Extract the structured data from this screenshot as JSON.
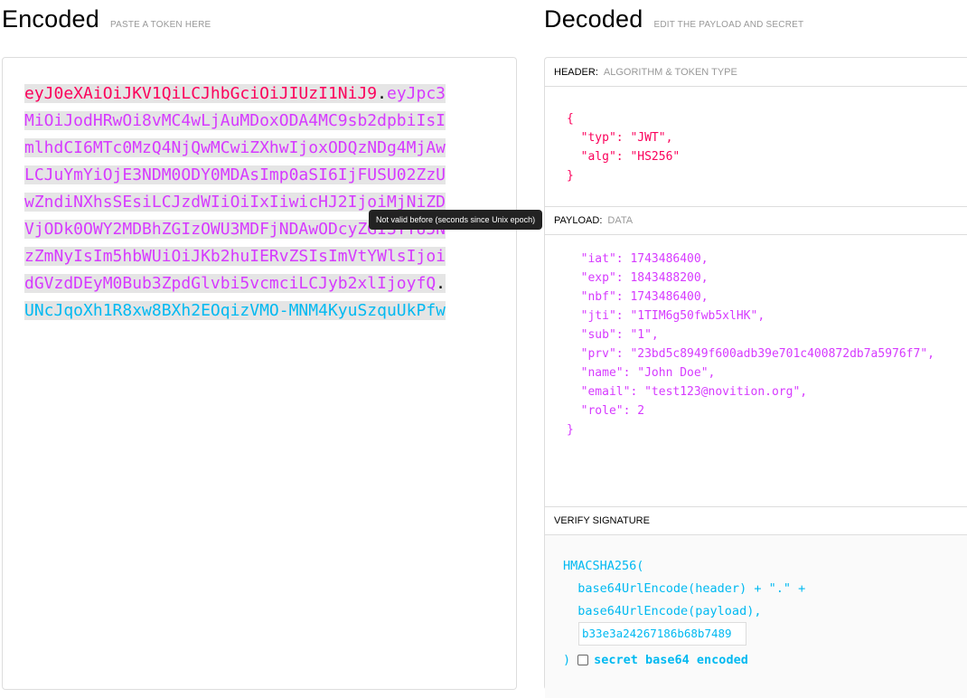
{
  "encoded": {
    "title": "Encoded",
    "subtitle": "PASTE A TOKEN HERE",
    "token": {
      "header": "eyJ0eXAiOiJKV1QiLCJhbGciOiJIUzI1NiJ9",
      "payload": "eyJpc3MiOiJodHRwOi8vMC4wLjAuMDoxODA4MC9sb2dpbiIsImlhdCI6MTc0MzQ4NjQwMCwiZXhwIjoxODQzNDg4MjAwLCJuYmYiOjE3NDM0ODY0MDAsImp0aSI6IjFUSU02ZzUwZndiNXhsSEsiLCJzdWIiOiIxIiwicHJ2IjoiMjNiZDVjODk0OWY2MDBhZGIzOWU3MDFjNDAwODcyZGI3YTU5NzZmNyIsIm5hbWUiOiJKb2huIERvZSIsImVtYWlsIjoidGVzdDEyM0Bub3ZpdGlvbi5vcmciLCJyb2xlIjoyfQ",
      "signature": "UNcJqoXh1R8xw8BXh2EOqizVMO-MNM4KyuSzquUkPfw",
      "dot": "."
    }
  },
  "tooltip": "Not valid before (seconds since Unix epoch)",
  "decoded": {
    "title": "Decoded",
    "subtitle": "EDIT THE PAYLOAD AND SECRET",
    "header_section": {
      "label": "HEADER:",
      "sub": "ALGORITHM & TOKEN TYPE"
    },
    "header_json": "{\n  \"typ\": \"JWT\",\n  \"alg\": \"HS256\"\n}",
    "payload_section": {
      "label": "PAYLOAD:",
      "sub": "DATA"
    },
    "payload_json": "  \"iat\": 1743486400,\n  \"exp\": 1843488200,\n  \"nbf\": 1743486400,\n  \"jti\": \"1TIM6g50fwb5xlHK\",\n  \"sub\": \"1\",\n  \"prv\": \"23bd5c8949f600adb39e701c400872db7a5976f7\",\n  \"name\": \"John Doe\",\n  \"email\": \"test123@novition.org\",\n  \"role\": 2\n}",
    "verify_section": {
      "label": "VERIFY SIGNATURE"
    },
    "verify_code": "HMACSHA256(\n  base64UrlEncode(header) + \".\" +\n  base64UrlEncode(payload),",
    "secret_value": "b33e3a24267186b68b7489",
    "closing_paren": ")",
    "checkbox_label": "secret base64 encoded"
  },
  "colors": {
    "header": "#fb015b",
    "payload": "#d63aff",
    "signature": "#00b9f1"
  }
}
